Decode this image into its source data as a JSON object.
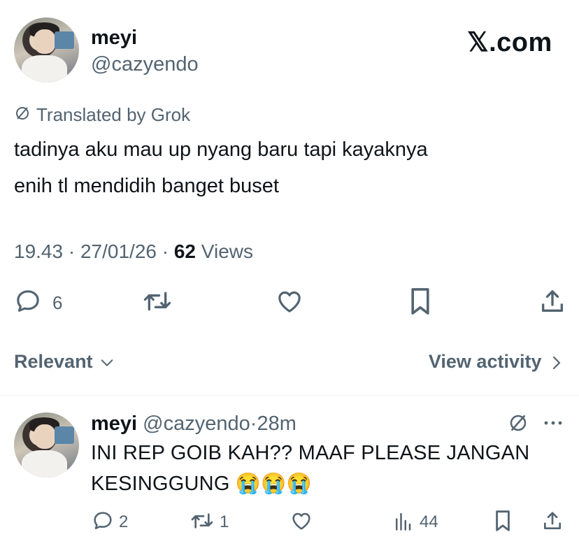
{
  "brand": {
    "logo_text": "𝕏.com"
  },
  "tweet": {
    "author_name": "meyi",
    "author_handle": "@cazyendo",
    "translated_label": "Translated by Grok",
    "text_line1": "tadinya aku mau up nyang baru tapi kayaknya",
    "text_line2": "enih tl mendidih banget buset",
    "time": "19.43",
    "sep1": "·",
    "date": "27/01/26",
    "sep2": "·",
    "views_count": "62",
    "views_label": "Views",
    "reply_count": "6"
  },
  "sort": {
    "label": "Relevant",
    "view_activity": "View activity"
  },
  "reply": {
    "author_name": "meyi",
    "author_handle": "@cazyendo",
    "sep": "·",
    "age": "28m",
    "text_line1": "INI REP GOIB KAH?? MAAF PLEASE JANGAN",
    "text_line2": "KESINGGUNG 😭😭😭",
    "reply_count": "2",
    "repost_count": "1",
    "views_count": "44"
  },
  "icons": {
    "reply": "speech-bubble-icon",
    "repost": "repost-arrows-icon",
    "like": "heart-icon",
    "bookmark": "bookmark-icon",
    "share": "share-upload-icon",
    "translate": "slashed-circle-icon",
    "more": "more-dots-icon",
    "views": "bar-chart-icon",
    "chevron_down": "chevron-down-icon",
    "chevron_right": "chevron-right-icon"
  },
  "colors": {
    "text": "#0f1419",
    "secondary": "#536471",
    "divider": "#eff3f4"
  }
}
